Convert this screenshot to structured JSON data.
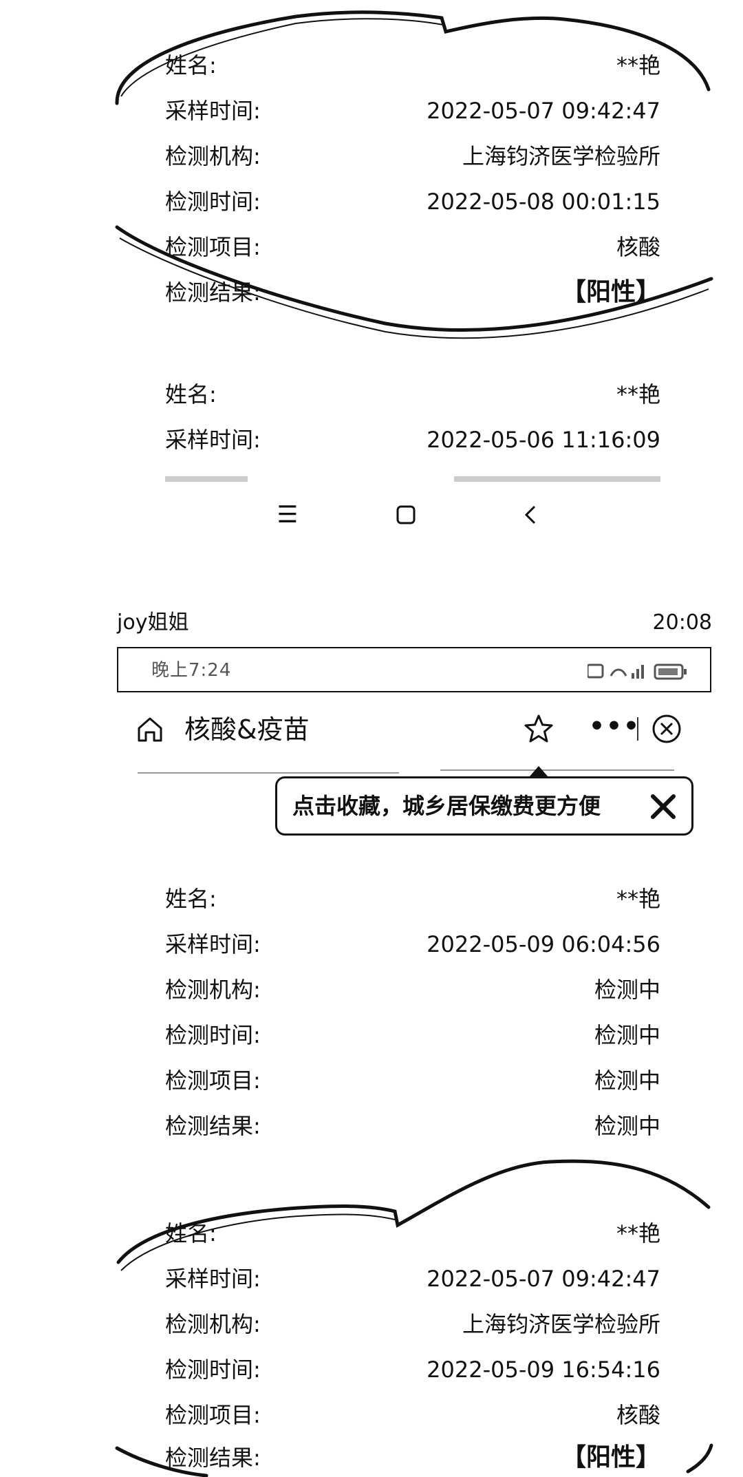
{
  "record_top": {
    "fields": [
      {
        "label": "姓名:",
        "value": "**艳"
      },
      {
        "label": "采样时间:",
        "value": "2022-05-07 09:42:47"
      },
      {
        "label": "检测机构:",
        "value": "上海钧济医学检验所"
      },
      {
        "label": "检测时间:",
        "value": "2022-05-08 00:01:15"
      },
      {
        "label": "检测项目:",
        "value": "核酸"
      },
      {
        "label": "检测结果:",
        "value": "【阳性】"
      }
    ]
  },
  "record_second": {
    "fields": [
      {
        "label": "姓名:",
        "value": "**艳"
      },
      {
        "label": "采样时间:",
        "value": "2022-05-06 11:16:09"
      }
    ]
  },
  "nav_bar": {
    "menu_icon": "☰",
    "home_icon": "▢",
    "back_icon": "‹"
  },
  "chat": {
    "sender": "joy姐姐",
    "time": "20:08"
  },
  "status_bar": {
    "clock": "晚上7:24"
  },
  "title_bar": {
    "title": "核酸&疫苗",
    "more_label": "•••"
  },
  "tooltip": {
    "text": "点击收藏，城乡居保缴费更方便"
  },
  "record_pending": {
    "fields": [
      {
        "label": "姓名:",
        "value": "**艳"
      },
      {
        "label": "采样时间:",
        "value": "2022-05-09 06:04:56"
      },
      {
        "label": "检测机构:",
        "value": "检测中"
      },
      {
        "label": "检测时间:",
        "value": "检测中"
      },
      {
        "label": "检测项目:",
        "value": "检测中"
      },
      {
        "label": "检测结果:",
        "value": "检测中"
      }
    ]
  },
  "record_bottom": {
    "fields": [
      {
        "label": "姓名:",
        "value": "**艳"
      },
      {
        "label": "采样时间:",
        "value": "2022-05-07 09:42:47"
      },
      {
        "label": "检测机构:",
        "value": "上海钧济医学检验所"
      },
      {
        "label": "检测时间:",
        "value": "2022-05-09 16:54:16"
      },
      {
        "label": "检测项目:",
        "value": "核酸"
      },
      {
        "label": "检测结果:",
        "value": "【阳性】"
      }
    ]
  },
  "colors": {
    "ink": "#111111",
    "background": "#ffffff"
  }
}
